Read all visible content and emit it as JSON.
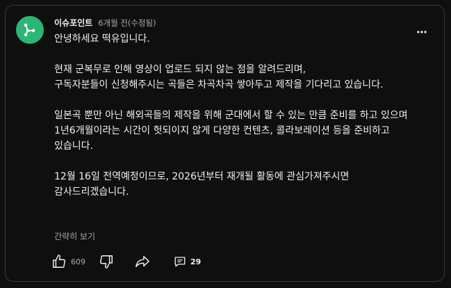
{
  "post": {
    "channel_name": "이슈포인트",
    "time": "6개월 전(수정됨)",
    "body": "안녕하세요 떡유입니다.\n\n현재 군복무로 인해 영상이 업로드 되지 않는 점을 알려드리며,\n구독자분들이 신청해주시는 곡들은 차곡차곡 쌓아두고 제작을 기다리고 있습니다.\n\n일본곡 뿐만 아닌 해외곡들의 제작을 위해 군대에서 할 수 있는 만큼 준비를 하고 있으며\n1년6개월이라는 시간이 헛되이지 않게 다양한 컨텐츠, 콜라보레이션 등을 준비하고 있습니다.\n\n12월 16일 전역예정이므로, 2026년부터 재개될 활동에 관심가져주시면 감사드리겠습니다.",
    "show_less_label": "간략히 보기"
  },
  "actions": {
    "like_count": "609",
    "comment_count": "29"
  },
  "icons": {
    "avatar": "network-nodes-icon",
    "more": "more-vertical-icon",
    "like": "thumbs-up-icon",
    "dislike": "thumbs-down-icon",
    "share": "share-icon",
    "comment": "comment-icon"
  },
  "colors": {
    "background": "#0f0f0f",
    "border": "#3a3a3a",
    "avatar_bg": "#2bb673",
    "text_primary": "#f1f1f1",
    "text_secondary": "#aaaaaa"
  }
}
